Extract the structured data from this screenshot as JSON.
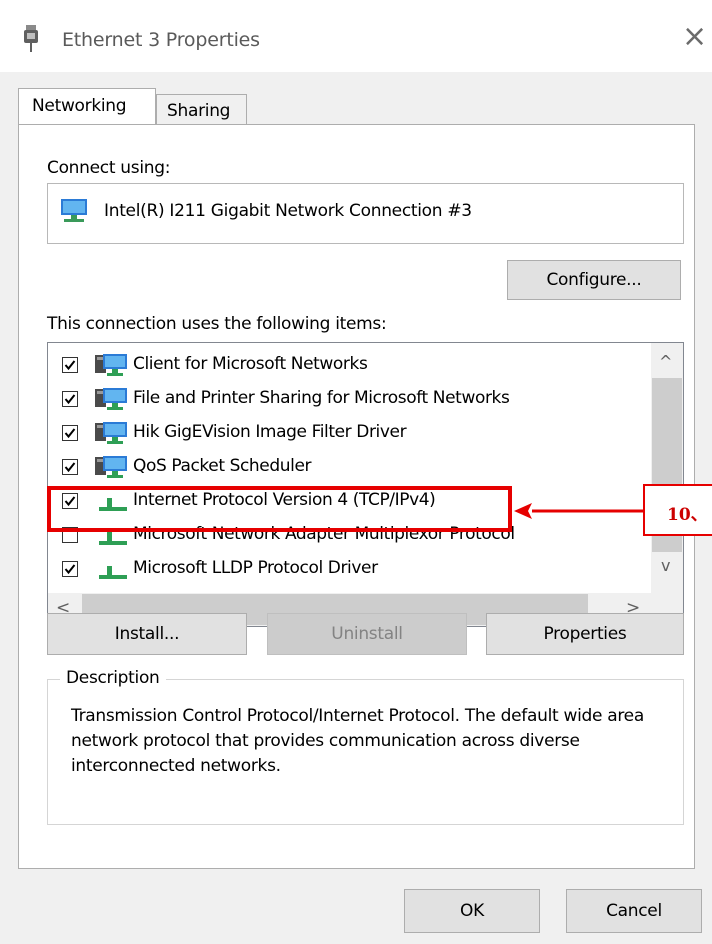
{
  "window": {
    "title": "Ethernet 3 Properties",
    "close_glyph": "×",
    "icon": "network-adapter-icon"
  },
  "tabs": [
    {
      "label": "Networking",
      "active": true
    },
    {
      "label": "Sharing",
      "active": false
    }
  ],
  "connect_using": {
    "label": "Connect using:",
    "adapter": "Intel(R) I211 Gigabit Network Connection #3",
    "adapter_icon": "network-adapter-icon"
  },
  "buttons": {
    "configure": "Configure...",
    "install": "Install...",
    "uninstall": "Uninstall",
    "properties": "Properties",
    "ok": "OK",
    "cancel": "Cancel"
  },
  "items_label": "This connection uses the following items:",
  "items": [
    {
      "label": "Client for Microsoft Networks",
      "checked": true,
      "icon": "network-client-icon"
    },
    {
      "label": "File and Printer Sharing for Microsoft Networks",
      "checked": true,
      "icon": "network-client-icon"
    },
    {
      "label": "Hik GigEVision Image Filter Driver",
      "checked": true,
      "icon": "network-client-icon"
    },
    {
      "label": "QoS Packet Scheduler",
      "checked": true,
      "icon": "network-client-icon"
    },
    {
      "label": "Internet Protocol Version 4 (TCP/IPv4)",
      "checked": true,
      "icon": "protocol-icon"
    },
    {
      "label": "Microsoft Network Adapter Multiplexor Protocol",
      "checked": false,
      "icon": "protocol-icon"
    },
    {
      "label": "Microsoft LLDP Protocol Driver",
      "checked": true,
      "icon": "protocol-icon"
    }
  ],
  "scroll": {
    "up": "^",
    "down": "v",
    "left": "<",
    "right": ">"
  },
  "description": {
    "legend": "Description",
    "text": "Transmission Control Protocol/Internet Protocol. The default wide area network protocol that provides communication across diverse interconnected networks."
  },
  "annotation": {
    "step_label": "10、",
    "color": "#e60000"
  }
}
